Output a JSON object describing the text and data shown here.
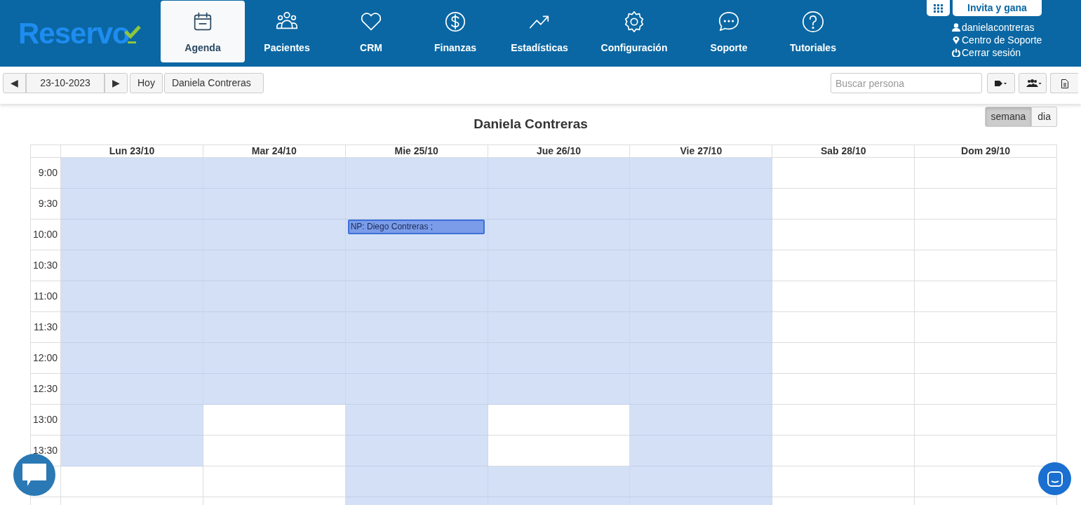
{
  "logo": "Reservo",
  "nav": [
    {
      "label": "Agenda",
      "selected": true
    },
    {
      "label": "Pacientes",
      "selected": false
    },
    {
      "label": "CRM",
      "selected": false
    },
    {
      "label": "Finanzas",
      "selected": false
    },
    {
      "label": "Estadísticas",
      "selected": false
    },
    {
      "label": "Configuración",
      "selected": false
    },
    {
      "label": "Soporte",
      "selected": false
    },
    {
      "label": "Tutoriales",
      "selected": false
    }
  ],
  "account": {
    "invite_button": "Invita y gana",
    "links": [
      "danielacontreras",
      "Centro de Soporte",
      "Cerrar sesión"
    ]
  },
  "toolbar": {
    "prev": "◀",
    "date": "23-10-2023",
    "next": "▶",
    "today": "Hoy",
    "professional": "Daniela Contreras",
    "search": {
      "placeholder": "Buscar persona"
    }
  },
  "calendar": {
    "title": "Daniela Contreras",
    "views": [
      {
        "label": "semana",
        "selected": true
      },
      {
        "label": "dia",
        "selected": false
      }
    ],
    "days": [
      "Lun 23/10",
      "Mar 24/10",
      "Mie 25/10",
      "Jue 26/10",
      "Vie 27/10",
      "Sab 28/10",
      "Dom 29/10"
    ],
    "rows": [
      {
        "time": "9:00",
        "slots": [
          {
            "available": true
          },
          {
            "available": true
          },
          {
            "available": true
          },
          {
            "available": true
          },
          {
            "available": true
          },
          {
            "available": false
          },
          {
            "available": false
          }
        ]
      },
      {
        "time": "9:30",
        "slots": [
          {
            "available": true
          },
          {
            "available": true
          },
          {
            "available": true
          },
          {
            "available": true
          },
          {
            "available": true
          },
          {
            "available": false
          },
          {
            "available": false
          }
        ]
      },
      {
        "time": "10:00",
        "slots": [
          {
            "available": true
          },
          {
            "available": true
          },
          {
            "available": true,
            "event": "NP: Diego Contreras ;"
          },
          {
            "available": true
          },
          {
            "available": true
          },
          {
            "available": false
          },
          {
            "available": false
          }
        ]
      },
      {
        "time": "10:30",
        "slots": [
          {
            "available": true
          },
          {
            "available": true
          },
          {
            "available": true
          },
          {
            "available": true
          },
          {
            "available": true
          },
          {
            "available": false
          },
          {
            "available": false
          }
        ]
      },
      {
        "time": "11:00",
        "slots": [
          {
            "available": true
          },
          {
            "available": true
          },
          {
            "available": true
          },
          {
            "available": true
          },
          {
            "available": true
          },
          {
            "available": false
          },
          {
            "available": false
          }
        ]
      },
      {
        "time": "11:30",
        "slots": [
          {
            "available": true
          },
          {
            "available": true
          },
          {
            "available": true
          },
          {
            "available": true
          },
          {
            "available": true
          },
          {
            "available": false
          },
          {
            "available": false
          }
        ]
      },
      {
        "time": "12:00",
        "slots": [
          {
            "available": true
          },
          {
            "available": true
          },
          {
            "available": true
          },
          {
            "available": true
          },
          {
            "available": true
          },
          {
            "available": false
          },
          {
            "available": false
          }
        ]
      },
      {
        "time": "12:30",
        "slots": [
          {
            "available": true
          },
          {
            "available": true
          },
          {
            "available": true
          },
          {
            "available": true
          },
          {
            "available": true
          },
          {
            "available": false
          },
          {
            "available": false
          }
        ]
      },
      {
        "time": "13:00",
        "slots": [
          {
            "available": true
          },
          {
            "available": false
          },
          {
            "available": true
          },
          {
            "available": false
          },
          {
            "available": true
          },
          {
            "available": false
          },
          {
            "available": false
          }
        ]
      },
      {
        "time": "13:30",
        "slots": [
          {
            "available": true
          },
          {
            "available": false
          },
          {
            "available": true
          },
          {
            "available": false
          },
          {
            "available": true
          },
          {
            "available": false
          },
          {
            "available": false
          }
        ]
      },
      {
        "slots": [
          {
            "available": false
          },
          {
            "available": false
          },
          {
            "available": true
          },
          {
            "available": true
          },
          {
            "available": true
          },
          {
            "available": false
          },
          {
            "available": false
          }
        ]
      },
      {
        "slots": [
          {
            "available": false
          },
          {
            "available": false
          },
          {
            "available": true
          },
          {
            "available": true
          },
          {
            "available": true
          },
          {
            "available": false
          },
          {
            "available": false
          }
        ]
      }
    ]
  }
}
